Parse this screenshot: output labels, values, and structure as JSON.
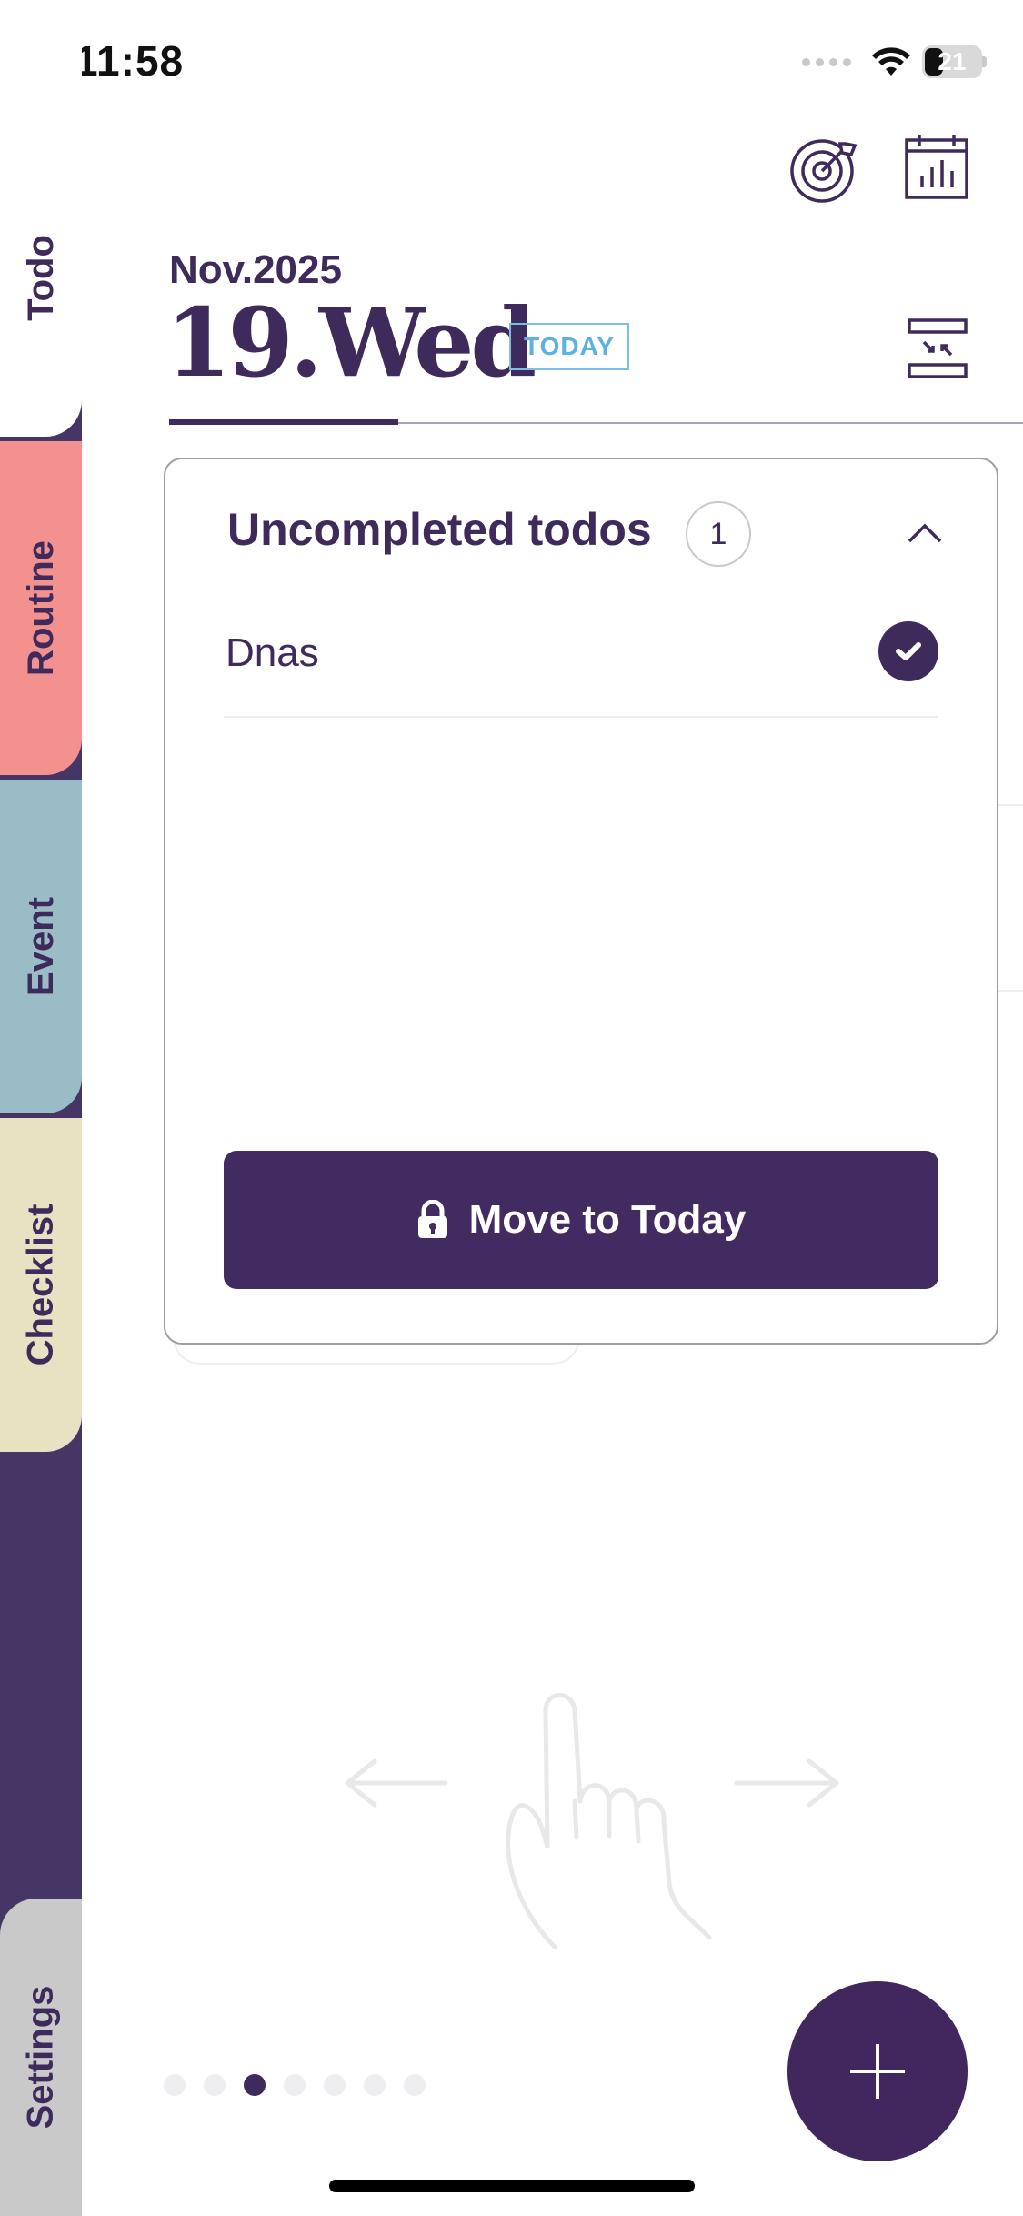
{
  "status_bar": {
    "time": "11:58",
    "battery_level": "21"
  },
  "side_tabs": [
    {
      "label": "Todo",
      "color": "#ffffff",
      "active": true
    },
    {
      "label": "Routine",
      "color": "#f3918f"
    },
    {
      "label": "Event",
      "color": "#9abcc7"
    },
    {
      "label": "Checklist",
      "color": "#e8e2c2"
    },
    {
      "label": "Settings",
      "color": "#c9c9c9"
    }
  ],
  "header": {
    "month_year": "Nov.2025",
    "day": "19.Wed",
    "today_badge": "TODAY",
    "icons": [
      "goal-target-icon",
      "stats-calendar-icon",
      "collapse-icon"
    ]
  },
  "popup": {
    "title": "Uncompleted todos",
    "count": "1",
    "items": [
      {
        "text": "Dnas",
        "checked": true
      }
    ],
    "move_button_label": "Move to Today"
  },
  "pager": {
    "total": 7,
    "active_index": 2
  },
  "colors": {
    "brand": "#3e2b5c",
    "rail": "#453665",
    "today": "#5cb0e2"
  }
}
